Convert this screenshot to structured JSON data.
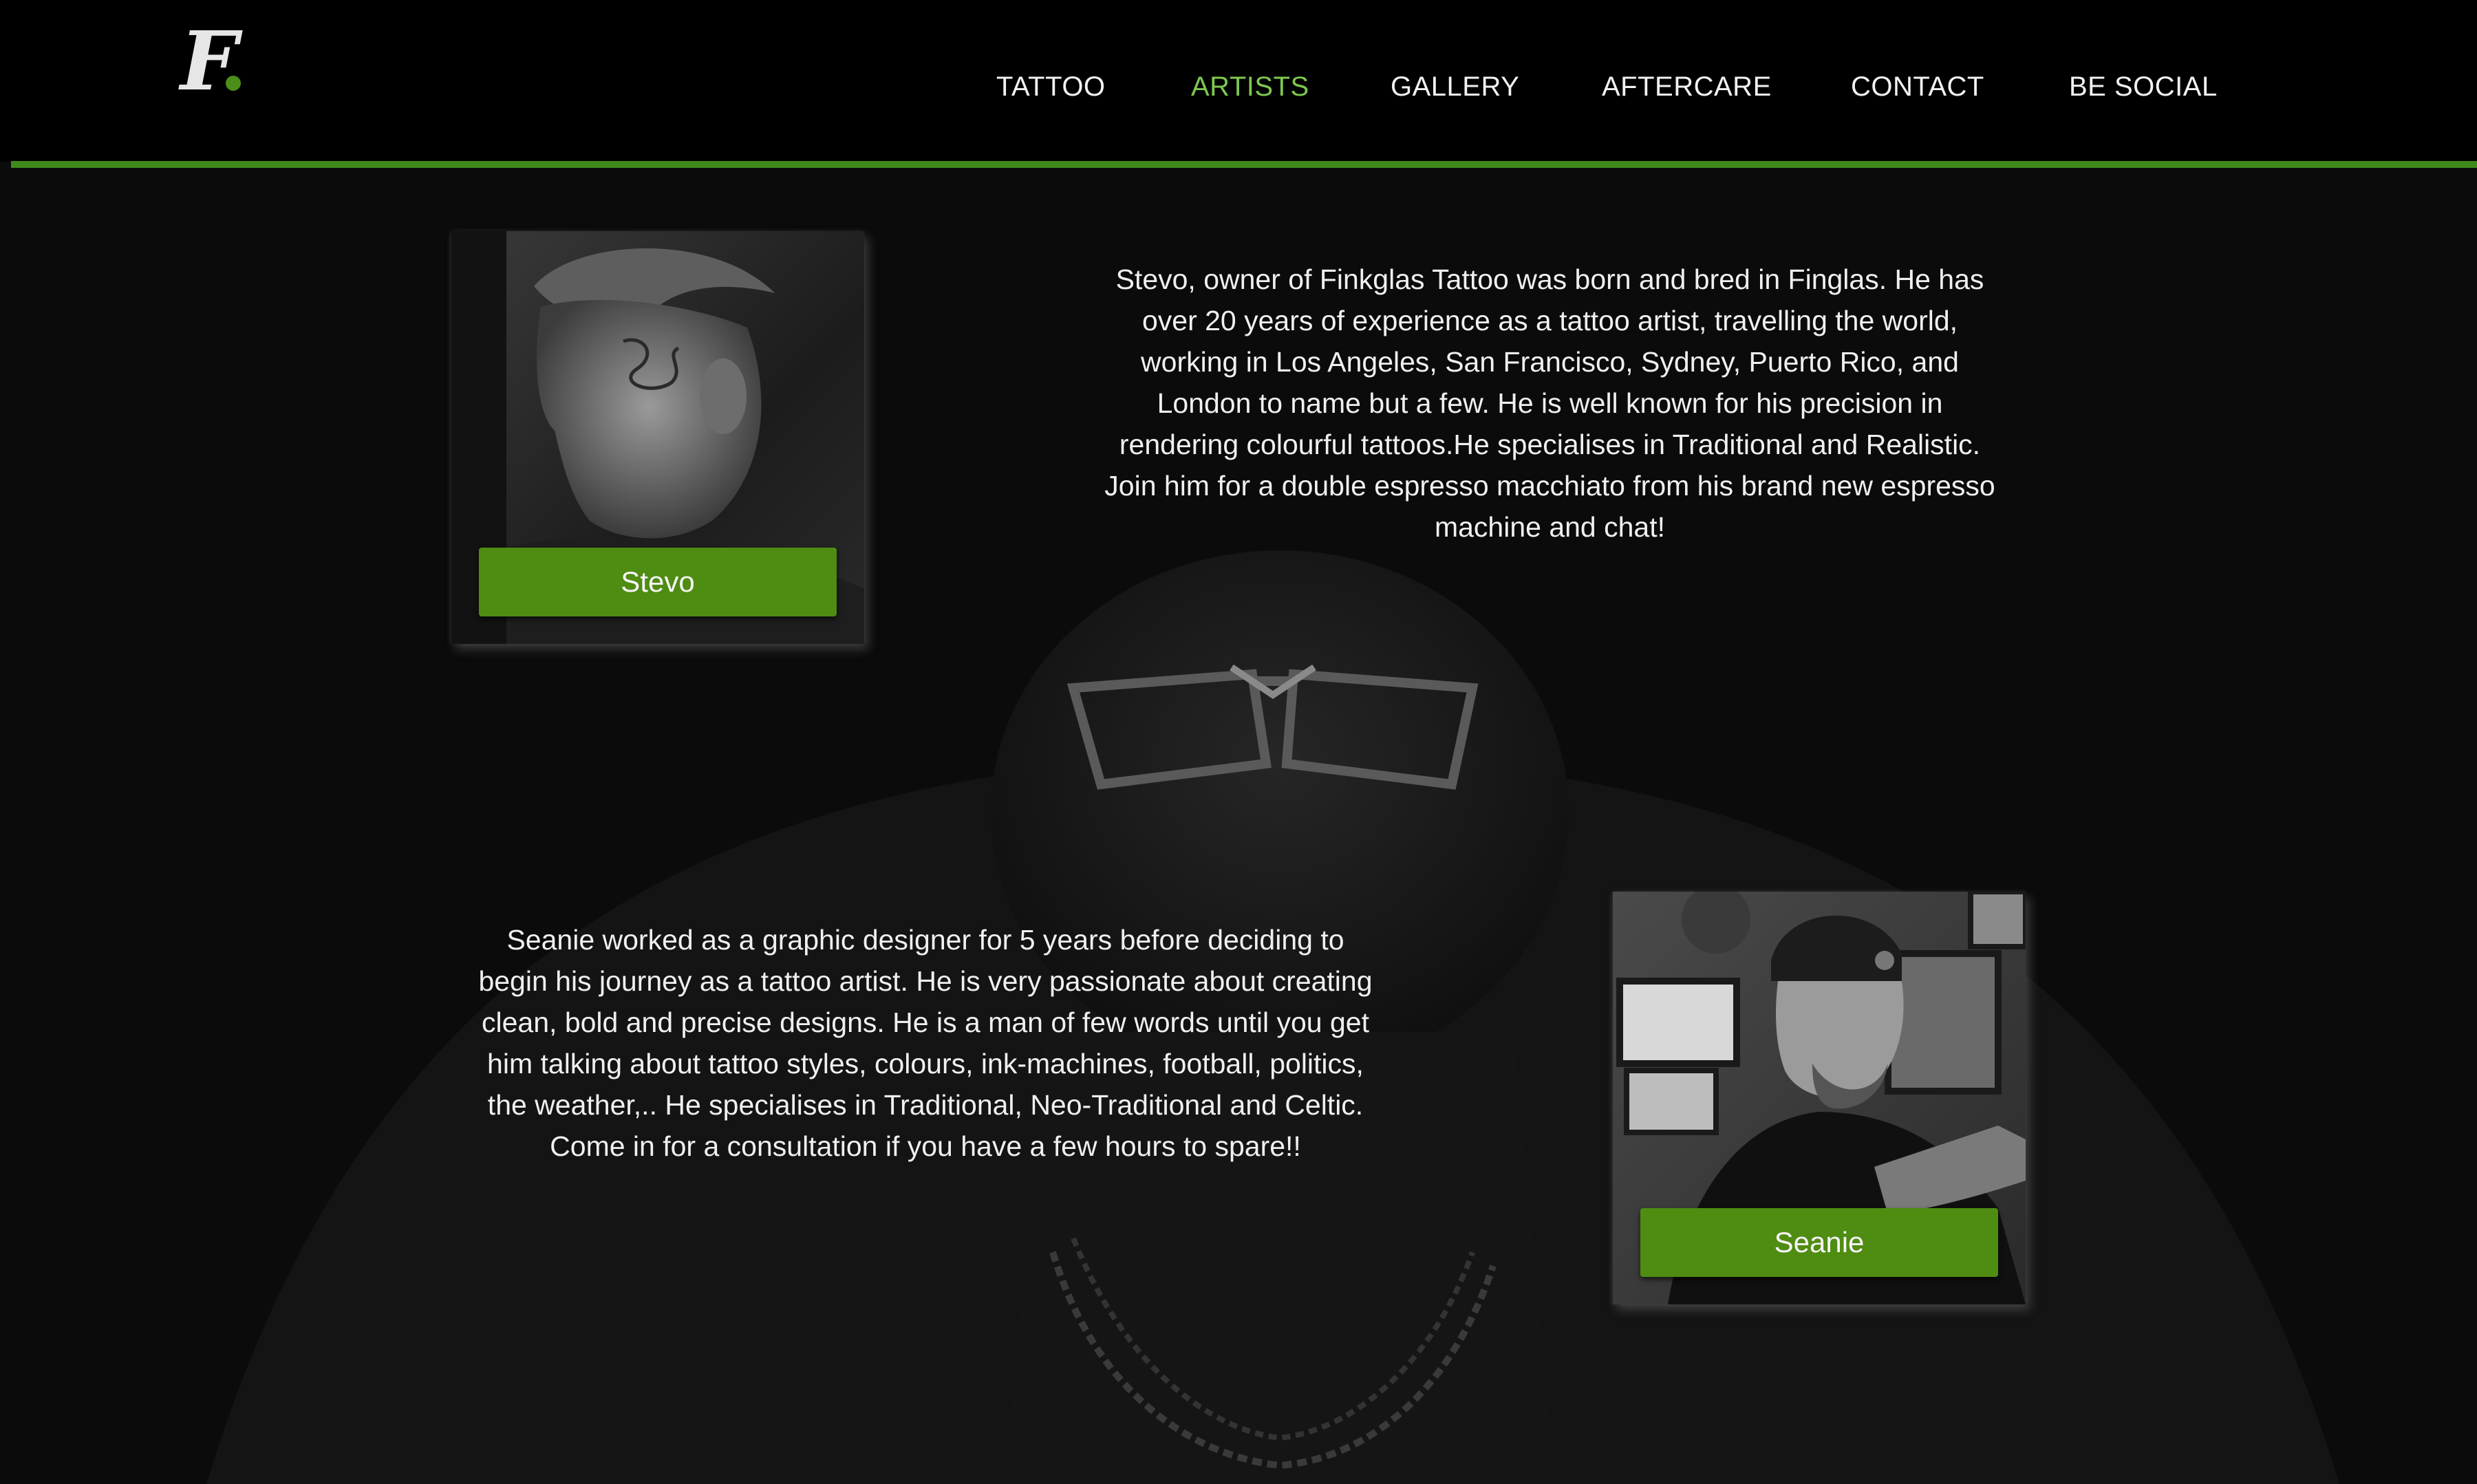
{
  "header": {
    "logo_text": "F",
    "nav": [
      {
        "label": "TATTOO",
        "active": false
      },
      {
        "label": "ARTISTS",
        "active": true
      },
      {
        "label": "GALLERY",
        "active": false
      },
      {
        "label": "AFTERCARE",
        "active": false
      },
      {
        "label": "CONTACT",
        "active": false
      },
      {
        "label": "BE SOCIAL",
        "active": false
      }
    ]
  },
  "colors": {
    "background": "#0b0b0b",
    "header": "#000000",
    "accent_green": "#4f8c12",
    "active_nav": "#7ec850",
    "rule_green": "#3f8a1a",
    "text": "#f0f0f0"
  },
  "artists": [
    {
      "name": "Stevo",
      "bio": "Stevo, owner of Finkglas Tattoo was born and bred in Finglas. He has over 20 years of experience as a tattoo artist, travelling the world, working in Los Angeles, San Francisco, Sydney, Puerto Rico, and London to name but a few. He is well known for his precision in rendering colourful tattoos.He specialises in Traditional and Realistic. Join him for a double espresso macchiato from his brand new espresso machine and chat!"
    },
    {
      "name": "Seanie",
      "bio": "Seanie worked as a graphic designer for 5 years before deciding to begin his journey as a tattoo artist. He is very passionate about creating clean, bold and precise designs. He is a man of few words until you get him talking about tattoo styles, colours, ink-machines, football, politics, the weather,.. He specialises in Traditional, Neo-Traditional and Celtic. Come in for a consultation if you have a few hours to spare!!"
    }
  ]
}
